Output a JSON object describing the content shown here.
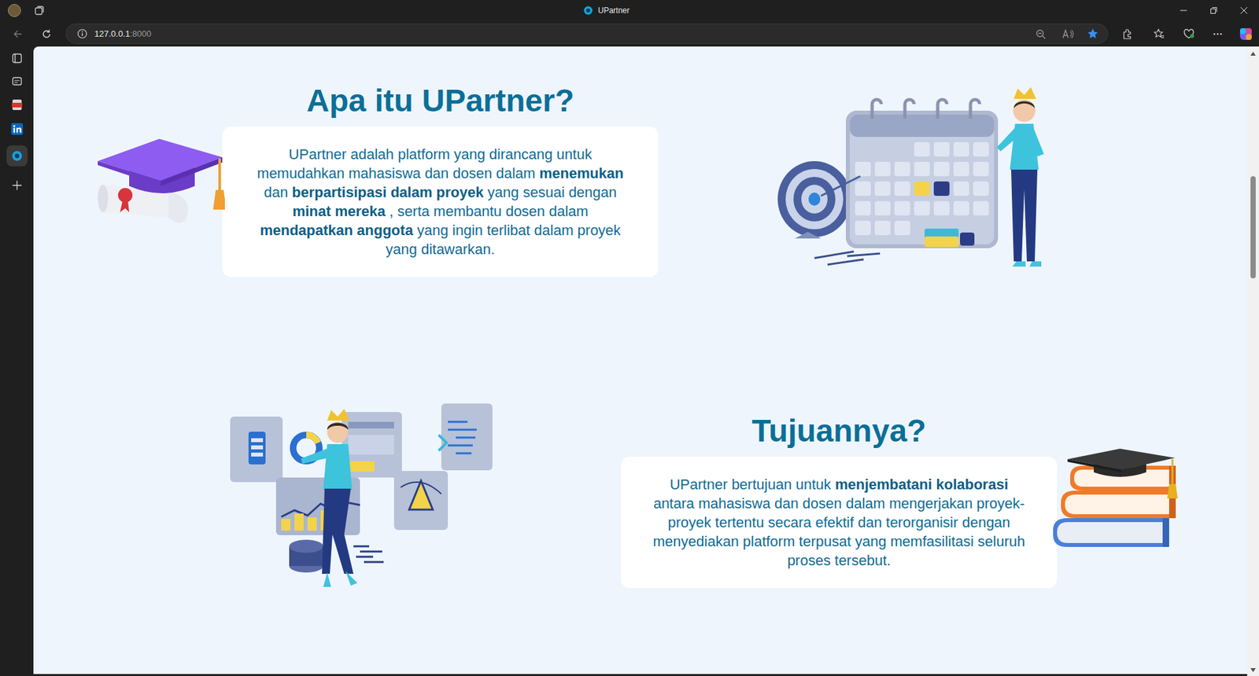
{
  "browser": {
    "tab_title": "UPartner",
    "address": {
      "host": "127.0.0.1",
      "port": ":8000"
    }
  },
  "sections": [
    {
      "kind": "text-left",
      "heading": "Apa itu UPartner?",
      "text": [
        {
          "t": "UPartner adalah platform yang dirancang untuk memudahkan mahasiswa dan dosen dalam ",
          "bold": false
        },
        {
          "t": "menemukan",
          "bold": true
        },
        {
          "t": " dan ",
          "bold": false
        },
        {
          "t": "berpartisipasi dalam proyek",
          "bold": true
        },
        {
          "t": " yang sesuai dengan ",
          "bold": false
        },
        {
          "t": "minat mereka",
          "bold": true
        },
        {
          "t": " , serta membantu dosen dalam ",
          "bold": false
        },
        {
          "t": "mendapatkan anggota",
          "bold": true
        },
        {
          "t": " yang ingin terlibat dalam proyek yang ditawarkan.",
          "bold": false
        }
      ]
    },
    {
      "kind": "text-right",
      "heading": "Tujuannya?",
      "text": [
        {
          "t": "UPartner bertujuan untuk ",
          "bold": false
        },
        {
          "t": "menjembatani kolaborasi",
          "bold": true
        },
        {
          "t": " antara mahasiswa dan dosen dalam mengerjakan proyek-proyek tertentu secara efektif dan terorganisir dengan menyediakan platform terpusat yang memfasilitasi seluruh proses tersebut.",
          "bold": false
        }
      ]
    }
  ]
}
